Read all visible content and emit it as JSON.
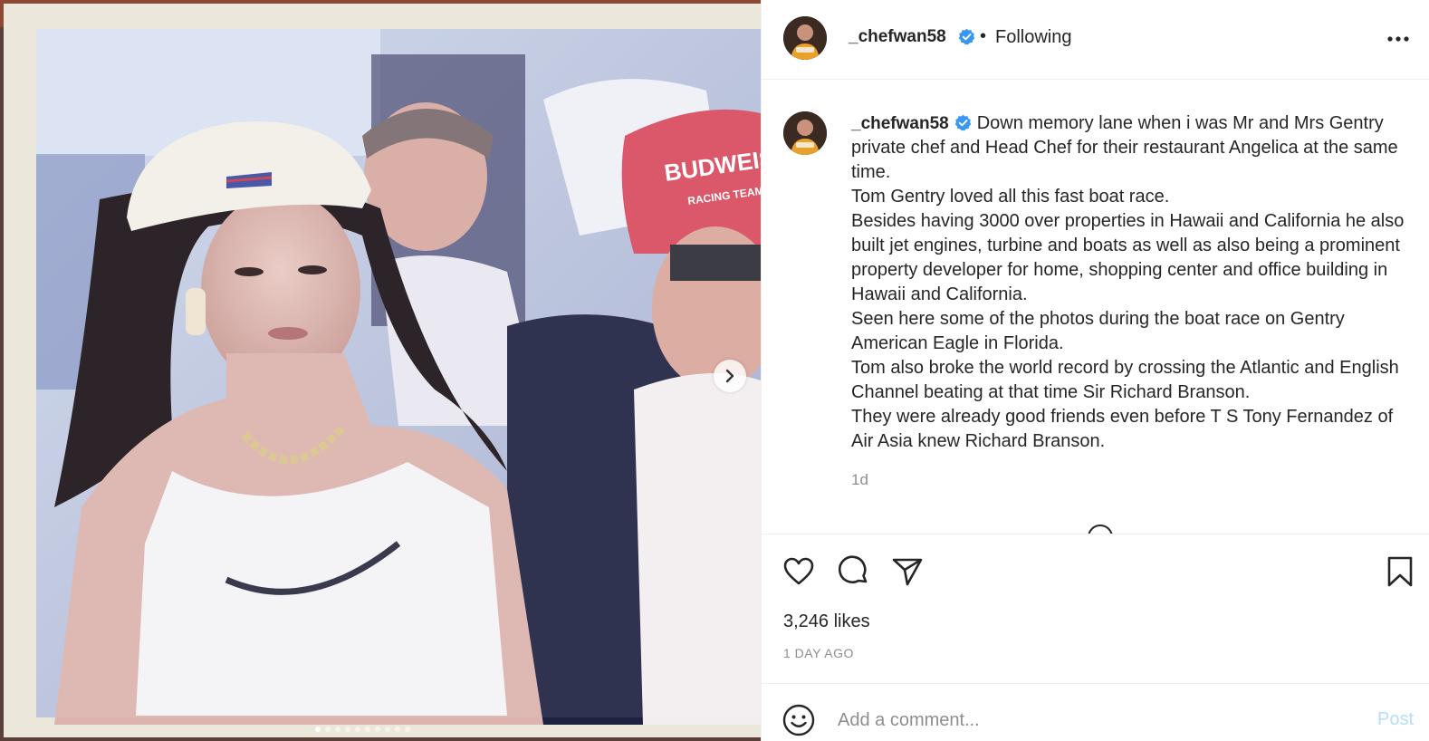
{
  "post": {
    "username": "_chefwan58",
    "verified": true,
    "follow_state": "Following",
    "separator": "•",
    "caption_lines": [
      "Down memory lane when i was Mr and Mrs Gentry private chef and Head Chef for their restaurant Angelica at the same time.",
      "Tom Gentry loved all this fast boat race.",
      "Besides having 3000 over properties in Hawaii and California he also built jet engines, turbine and boats as well as also being a prominent property developer for home, shopping center and office building in Hawaii and California.",
      "Seen here some of the photos during the boat race on Gentry American Eagle in Florida.",
      "Tom also broke the world record by crossing the Atlantic and English Channel beating at that time Sir Richard Branson.",
      "They were already good friends even before T S Tony Fernandez of Air Asia knew Richard Branson."
    ],
    "caption_age": "1d",
    "likes": "3,246 likes",
    "time_ago": "1 DAY AGO",
    "carousel": {
      "slide_count": 10,
      "active_index": 0
    },
    "photo": {
      "cap_text": "BUDWEISER",
      "cap_subtext": "RACING TEAM"
    }
  },
  "comment": {
    "placeholder": "Add a comment...",
    "post_label": "Post"
  },
  "icons": {
    "more": "more-horizontal-icon",
    "like": "heart-icon",
    "comment": "comment-bubble-icon",
    "share": "paper-plane-icon",
    "save": "bookmark-icon",
    "emoji": "smiley-icon",
    "verified": "verified-badge-icon",
    "next": "chevron-right-icon"
  },
  "colors": {
    "verified": "#3897f0",
    "muted": "#8e8e8e",
    "post_disabled": "#b2dffc",
    "text": "#262626"
  }
}
